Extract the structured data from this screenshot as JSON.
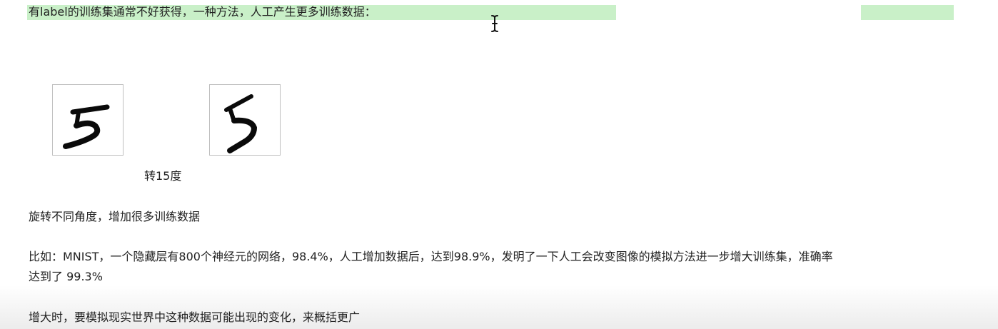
{
  "content": {
    "intro": "有label的训练集通常不好获得，一种方法，人工产生更多训练数据：",
    "rotation_caption": "转15度",
    "rotate_note": "旋转不同角度，增加很多训练数据",
    "example_line1": "比如：MNIST，一个隐藏层有800个神经元的网络，98.4%，人工增加数据后，达到98.9%，发明了一下人工会改变图像的模拟方法进一步增大训练集，准确率",
    "example_line2": "达到了 99.3%",
    "enlarge_note": "增大时，要模拟现实世界中这种数据可能出现的变化，来概括更广"
  },
  "colors": {
    "highlight": "#c9f0c8",
    "text": "#222222",
    "border": "#bfbfbf"
  },
  "icons": {
    "cursor": "text-cursor-icon"
  }
}
